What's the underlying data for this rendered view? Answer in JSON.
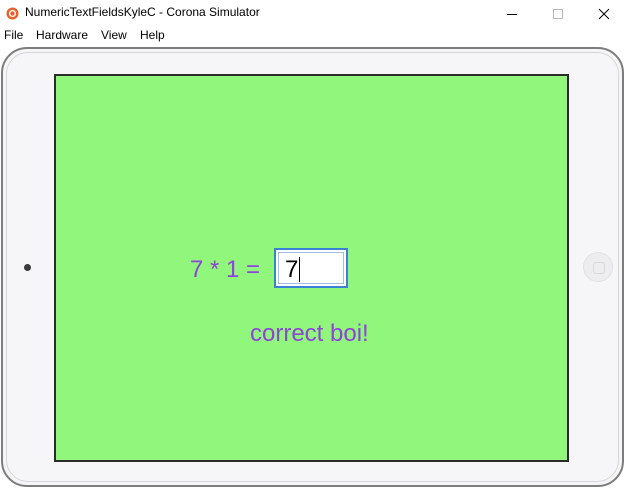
{
  "window": {
    "title": "NumericTextFieldsKyleC - Corona Simulator",
    "app_icon": "corona-icon",
    "controls": {
      "minimize": "minimize-icon",
      "maximize": "maximize-icon",
      "close": "close-icon"
    }
  },
  "menu": {
    "items": [
      {
        "label": "File"
      },
      {
        "label": "Hardware"
      },
      {
        "label": "View"
      },
      {
        "label": "Help"
      }
    ]
  },
  "app": {
    "equation": "7 * 1 =",
    "answer_value": "7",
    "feedback": "correct boi!",
    "colors": {
      "background": "#90f77c",
      "text": "#8f43d8",
      "field_border": "#3b82d6"
    }
  }
}
